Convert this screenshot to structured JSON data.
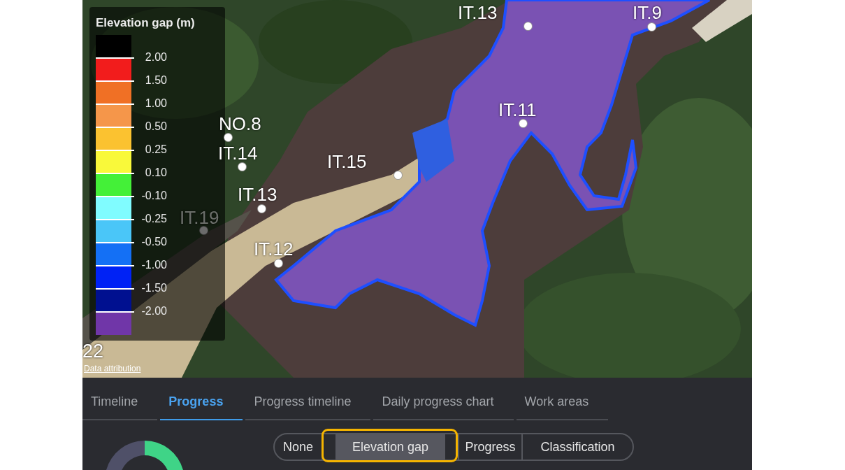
{
  "legend": {
    "title": "Elevation gap (m)",
    "bands": [
      {
        "color": "#000000"
      },
      {
        "color": "#f21c1c"
      },
      {
        "color": "#f07025"
      },
      {
        "color": "#f5964a"
      },
      {
        "color": "#fbc230"
      },
      {
        "color": "#f9f93a"
      },
      {
        "color": "#44f038"
      },
      {
        "color": "#80fcff"
      },
      {
        "color": "#4ac6f8"
      },
      {
        "color": "#1470f5"
      },
      {
        "color": "#0022f5"
      },
      {
        "color": "#001090"
      },
      {
        "color": "#7036a8"
      }
    ],
    "ticks": [
      "2.00",
      "1.50",
      "1.00",
      "0.50",
      "0.25",
      "0.10",
      "-0.10",
      "-0.25",
      "-0.50",
      "-1.00",
      "-1.50",
      "-2.00"
    ]
  },
  "map": {
    "markers": [
      {
        "label": "IT.13",
        "faded": false
      },
      {
        "label": "IT.9",
        "faded": false
      },
      {
        "label": "IT.11",
        "faded": false
      },
      {
        "label": "NO.8",
        "faded": false
      },
      {
        "label": "IT.14",
        "faded": false
      },
      {
        "label": "IT.15",
        "faded": false
      },
      {
        "label": "IT.13",
        "faded": false
      },
      {
        "label": "IT.19",
        "faded": true
      },
      {
        "label": "IT.12",
        "faded": false
      }
    ],
    "edge_label": "22",
    "attribution": "Data attribution"
  },
  "tabs": [
    {
      "label": "Timeline",
      "selected": false
    },
    {
      "label": "Progress",
      "selected": true
    },
    {
      "label": "Progress timeline",
      "selected": false
    },
    {
      "label": "Daily progress chart",
      "selected": false
    },
    {
      "label": "Work areas",
      "selected": false
    }
  ],
  "display_modes": [
    {
      "label": "None",
      "selected": false,
      "highlighted": false
    },
    {
      "label": "Elevation gap",
      "selected": true,
      "highlighted": true
    },
    {
      "label": "Progress",
      "selected": false,
      "highlighted": false
    },
    {
      "label": "Classification",
      "selected": false,
      "highlighted": false
    }
  ]
}
